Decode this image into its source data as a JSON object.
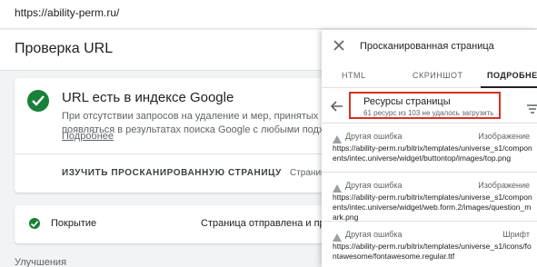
{
  "browser": {
    "url": "https://ability-perm.ru/"
  },
  "page": {
    "title": "Проверка URL"
  },
  "index_card": {
    "heading": "URL есть в индексе Google",
    "description_line1": "При отсутствии запросов на удаление и мер, принятых вручную,",
    "description_line2": "появляться в результатах поиска Google с любыми подходящим",
    "more_link": "Подробнее",
    "inspect_button": "ИЗУЧИТЬ ПРОСКАНИРОВАННУЮ СТРАНИЦУ",
    "crawled_label": "Страниц"
  },
  "coverage_card": {
    "label": "Покрытие",
    "status": "Страница отправлена и проин"
  },
  "improvements_label": "Улучшения",
  "panel": {
    "title": "Просканированная страница",
    "tabs": [
      {
        "label": "HTML",
        "active": false
      },
      {
        "label": "СКРИНШОТ",
        "active": false
      },
      {
        "label": "ПОДРОБНЕЕ",
        "active": true
      }
    ],
    "resources": {
      "title": "Ресурсы страницы",
      "summary": "61 ресурс из 103 не удалось загрузить",
      "highlight_color": "#d93025"
    },
    "items": [
      {
        "error": "Другая ошибка",
        "type": "Изображение",
        "url": "https://ability-perm.ru/bitrix/templates/universe_s1/components/intec.universe/widget/buttontop/images/top.png"
      },
      {
        "error": "Другая ошибка",
        "type": "Изображение",
        "url": "https://ability-perm.ru/bitrix/templates/universe_s1/components/intec.universe/widget/web.form.2/images/question_mark.png"
      },
      {
        "error": "Другая ошибка",
        "type": "Шрифт",
        "url": "https://ability-perm.ru/bitrix/templates/universe_s1/icons/fontawesome/fontawesome.regular.ttf"
      }
    ]
  }
}
